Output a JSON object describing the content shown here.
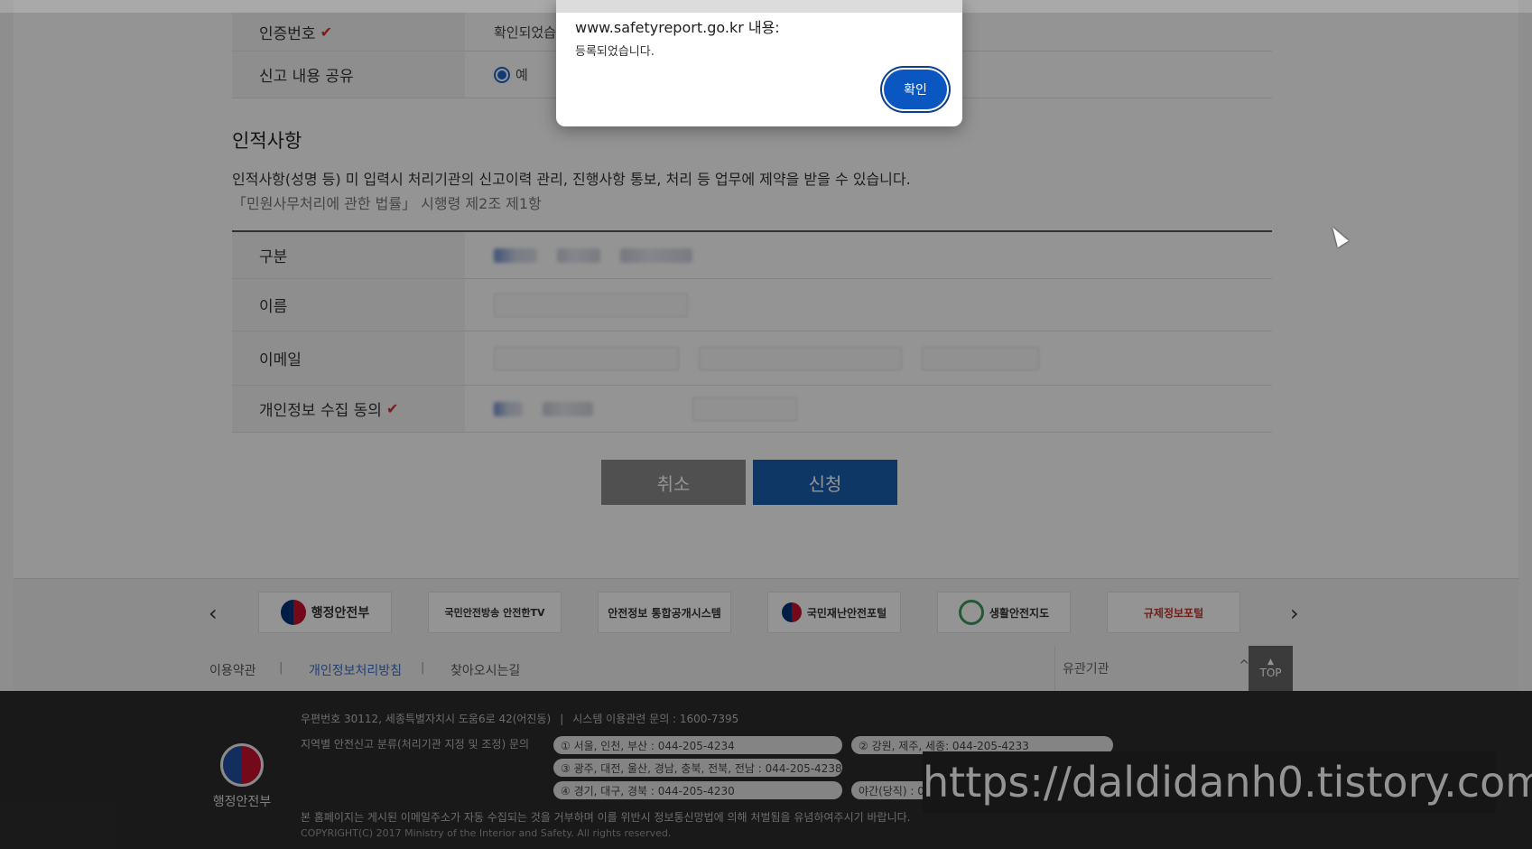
{
  "dialog": {
    "origin": "www.safetyreport.go.kr 내용:",
    "message": "등록되었습니다.",
    "ok_label": "확인"
  },
  "report_rows": [
    {
      "label": "인증번호",
      "value": "확인되었습",
      "required": true
    },
    {
      "label": "신고 내용 공유",
      "value": "예"
    }
  ],
  "personal": {
    "title": "인적사항",
    "desc": "인적사항(성명 등) 미 입력시 처리기관의 신고이력 관리, 진행사항 통보, 처리 등 업무에 제약을 받을 수 있습니다.",
    "law": "「민원사무처리에 관한 법률」 시행령 제2조 제1항",
    "rows": [
      {
        "label": "구분"
      },
      {
        "label": "이름"
      },
      {
        "label": "이메일"
      },
      {
        "label": "개인정보 수집 동의",
        "required": true
      }
    ]
  },
  "buttons": {
    "cancel": "취소",
    "submit": "신청"
  },
  "partners": [
    "행정안전부",
    "국민안전방송 안전한TV",
    "안전정보 통합공개시스템",
    "국민재난안전포털",
    "생활안전지도",
    "규제정보포털"
  ],
  "footer_links": {
    "terms": "이용약관",
    "privacy": "개인정보처리방침",
    "directions": "찾아오시는길",
    "related": "유관기관",
    "top": "TOP"
  },
  "footer": {
    "address": "우편번호 30112, 세종특별자치시 도움6로 42(어진동)",
    "system_inquiry": "시스템 이용관련 문의 : 1600-7395",
    "region_label": "지역별 안전신고 분류(처리기관 지정 및 조정) 문의",
    "region_contacts": [
      "① 서울, 인천, 부산 : 044-205-4234",
      "② 강원, 제주, 세종: 044-205-4233",
      "③ 광주, 대전, 울산, 경남, 충북, 전북, 전남 : 044-205-4238",
      "④ 경기, 대구, 경북 : 044-205-4230",
      "야간(당직) : 044-20"
    ],
    "email_notice": "본 홈페이지는 게시된 이메일주소가 자동 수집되는 것을 거부하며 이를 위반시 정보통신망법에 의해 처벌됨을 유념하여주시기 바랍니다.",
    "copyright": "COPYRIGHT(C) 2017 Ministry of the Interior and Safety. All rights reserved.",
    "logo_text": "행정안전부"
  },
  "watermark": "https://daldidanh0.tistory.com"
}
